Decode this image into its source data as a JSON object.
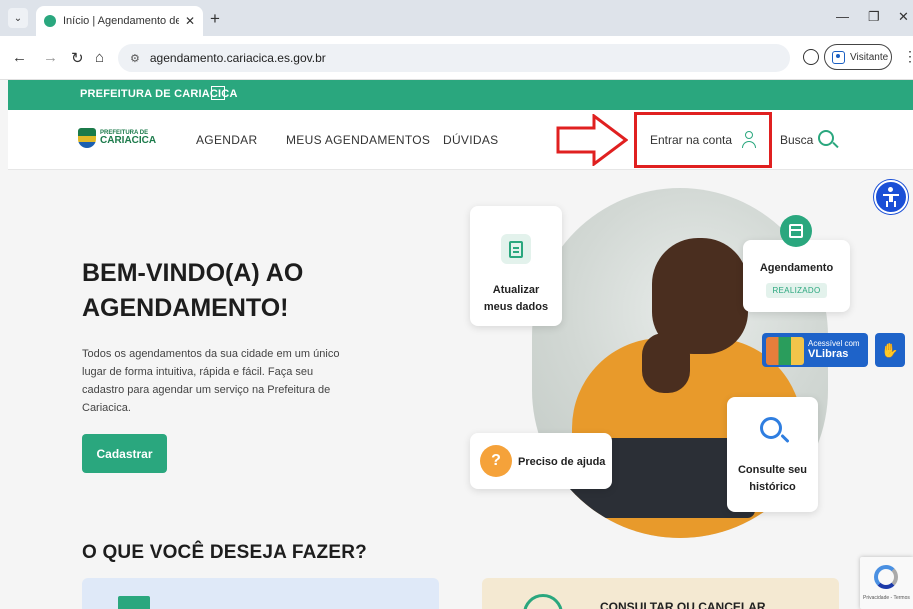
{
  "browser": {
    "tab_title": "Início | Agendamento de Cariaci",
    "new_tab": "+",
    "url": "agendamento.cariacica.es.gov.br",
    "profile_label": "Visitante"
  },
  "topbar": {
    "prefeitura_link": "PREFEITURA DE CARIACICA"
  },
  "header": {
    "logo_small": "PREFEITURA DE",
    "logo_big": "CARIACICA",
    "menu": [
      "AGENDAR",
      "MEUS AGENDAMENTOS",
      "DÚVIDAS"
    ],
    "login_label": "Entrar na conta",
    "search_label": "Busca"
  },
  "hero": {
    "title_line1": "BEM-VINDO(A) AO",
    "title_line2": "AGENDAMENTO!",
    "description": "Todos os agendamentos da sua cidade em um único lugar de forma intuitiva, rápida e fácil. Faça seu cadastro para agendar um serviço na Prefeitura de Cariacica.",
    "cta_label": "Cadastrar"
  },
  "cards": {
    "update_line1": "Atualizar",
    "update_line2": "meus dados",
    "scheduling_title": "Agendamento",
    "scheduling_status": "REALIZADO",
    "help_label": "Preciso de ajuda",
    "help_symbol": "?",
    "history_line1": "Consulte seu",
    "history_line2": "histórico"
  },
  "vlibras": {
    "small": "Acessível com",
    "big": "VLibras"
  },
  "section": {
    "title": "O QUE VOCÊ DESEJA FAZER?",
    "right_option": "CONSULTAR OU CANCELAR"
  },
  "recaptcha": {
    "footer": "Privacidade - Termos"
  },
  "colors": {
    "brand_green": "#2aa77e",
    "highlight_red": "#e02020",
    "vlibras_blue": "#1e63c9"
  }
}
